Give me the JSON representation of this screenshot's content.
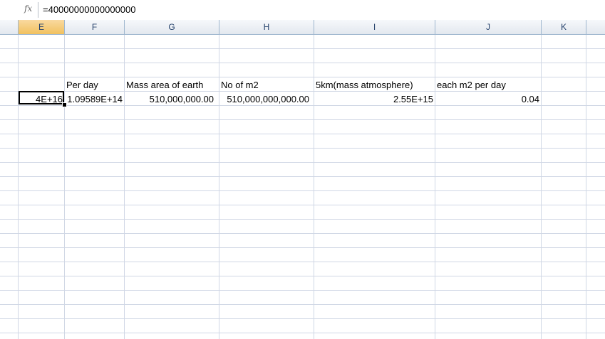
{
  "formula_bar": {
    "fx_label": "fx",
    "formula": "=40000000000000000"
  },
  "columns": [
    "E",
    "F",
    "G",
    "H",
    "I",
    "J",
    "K"
  ],
  "active_column": "E",
  "headers_row": {
    "F": "Per day",
    "G": "Mass area of earth",
    "H": "No of m2",
    "I": "5km(mass atmosphere)",
    "J": "each m2 per day"
  },
  "values_row": {
    "E": "4E+16",
    "F": "1.09589E+14",
    "G": "510,000,000.00",
    "H": "510,000,000,000.00",
    "I": "2.55E+15",
    "J": "0.04"
  },
  "colors": {
    "gridline": "#d0d7e5",
    "header_border": "#9eb6ce",
    "active_header": "#f1c15f"
  }
}
